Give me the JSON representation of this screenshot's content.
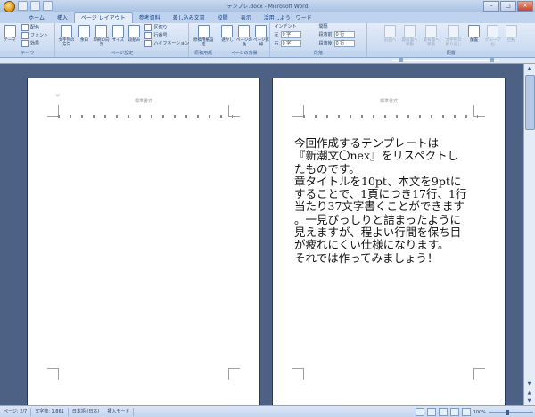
{
  "window": {
    "title": "テンプレ.docx - Microsoft Word",
    "controls": {
      "minimize": "–",
      "maximize": "□",
      "close": "×"
    }
  },
  "tabs": [
    {
      "label": "ホーム"
    },
    {
      "label": "挿入"
    },
    {
      "label": "ページ レイアウト",
      "active": true
    },
    {
      "label": "参考資料"
    },
    {
      "label": "差し込み文書"
    },
    {
      "label": "校閲"
    },
    {
      "label": "表示"
    },
    {
      "label": "活用しよう！ワード"
    }
  ],
  "ribbon": {
    "theme": {
      "group_label": "テーマ",
      "theme_button": "テーマ",
      "colors": "配色",
      "fonts": "フォント",
      "effects": "効果"
    },
    "page_setup": {
      "group_label": "ページ設定",
      "text_direction": "文字列の方向",
      "margins": "余白",
      "orientation": "印刷の向き",
      "size": "サイズ",
      "columns": "段組み",
      "breaks": "区切り",
      "line_numbers": "行番号",
      "hyphenation": "ハイフネーション"
    },
    "genko": {
      "group_label": "原稿用紙",
      "genko_button": "原稿用紙設定"
    },
    "background": {
      "group_label": "ページの背景",
      "watermark": "透かし",
      "page_color": "ページの色",
      "page_borders": "ページ罫線"
    },
    "paragraph": {
      "group_label": "段落",
      "indent_title": "インデント",
      "spacing_title": "間隔",
      "indent_left_label": "左",
      "indent_left_value": "0 字",
      "indent_right_label": "右",
      "indent_right_value": "0 字",
      "spacing_before_label": "段落前",
      "spacing_before_value": "0 行",
      "spacing_after_label": "段落後",
      "spacing_after_value": "0 行"
    },
    "arrange": {
      "group_label": "配置",
      "front": "前面へ",
      "forward": "最前面へ移動",
      "backward": "最背面へ移動",
      "wrap": "文字列の折り返し",
      "align": "配置",
      "group": "グループ化",
      "rotate": "回転"
    }
  },
  "pages": {
    "header_text": "標準書式",
    "para_mark": "↵",
    "right_page_text": "今回作成するテンプレートは\n『新潮文〇nex』をリスペクトし\nたものです。\n章タイトルを10pt、本文を9ptに\nすることで、1頁につき17行、1行\n当たり37文字書くことができます\n。一見びっしりと詰まったように\n見えますが、程よい行間を保ち目\nが疲れにくい仕様になります。\nそれでは作ってみましょう！"
  },
  "statusbar": {
    "page": "ページ: 2/7",
    "word_count": "文字数: 1,861",
    "language": "日本語 (日本)",
    "mode": "挿入モード",
    "zoom": "100%"
  }
}
